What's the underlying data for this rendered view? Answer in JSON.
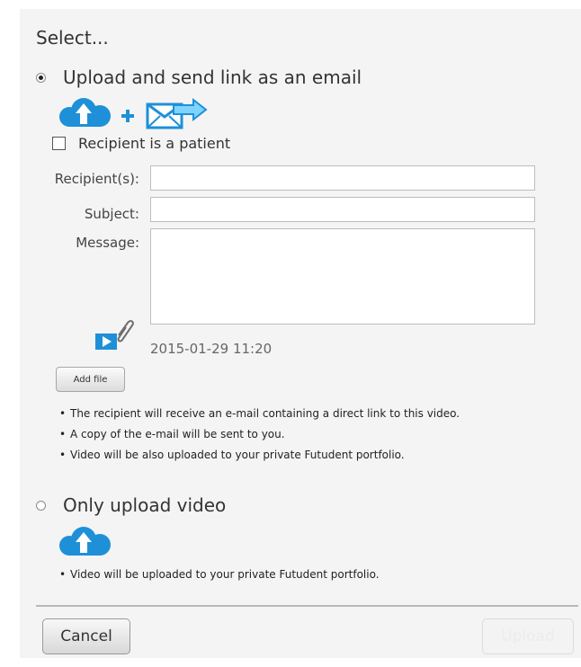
{
  "dialog": {
    "title": "Select..."
  },
  "options": {
    "email": {
      "label": "Upload and send link as an email",
      "selected": true
    },
    "upload_only": {
      "label": "Only upload video",
      "selected": false
    }
  },
  "recipient_checkbox": {
    "label": "Recipient is a patient",
    "checked": false
  },
  "fields": {
    "recipients_label": "Recipient(s):",
    "recipients_value": "",
    "subject_label": "Subject:",
    "subject_value": "",
    "message_label": "Message:",
    "message_value": ""
  },
  "attachment": {
    "timestamp": "2015-01-29 11:20",
    "add_file_label": "Add file"
  },
  "email_notes": [
    "The recipient will receive an e-mail containing a direct link to this video.",
    "A copy of the e-mail will be sent to you.",
    "Video will be also uploaded to your private Futudent portfolio."
  ],
  "upload_notes": [
    "Video will be uploaded to your private Futudent portfolio."
  ],
  "footer": {
    "cancel_label": "Cancel",
    "upload_label": "Upload"
  },
  "icons": {
    "cloud_upload": "cloud-upload-icon",
    "plus": "plus-icon",
    "email_send": "email-send-icon",
    "video_attachment": "video-attachment-icon"
  },
  "colors": {
    "brand_blue": "#1e90d8",
    "light_blue": "#7fd3ff",
    "dialog_bg": "#f4f4f4"
  }
}
